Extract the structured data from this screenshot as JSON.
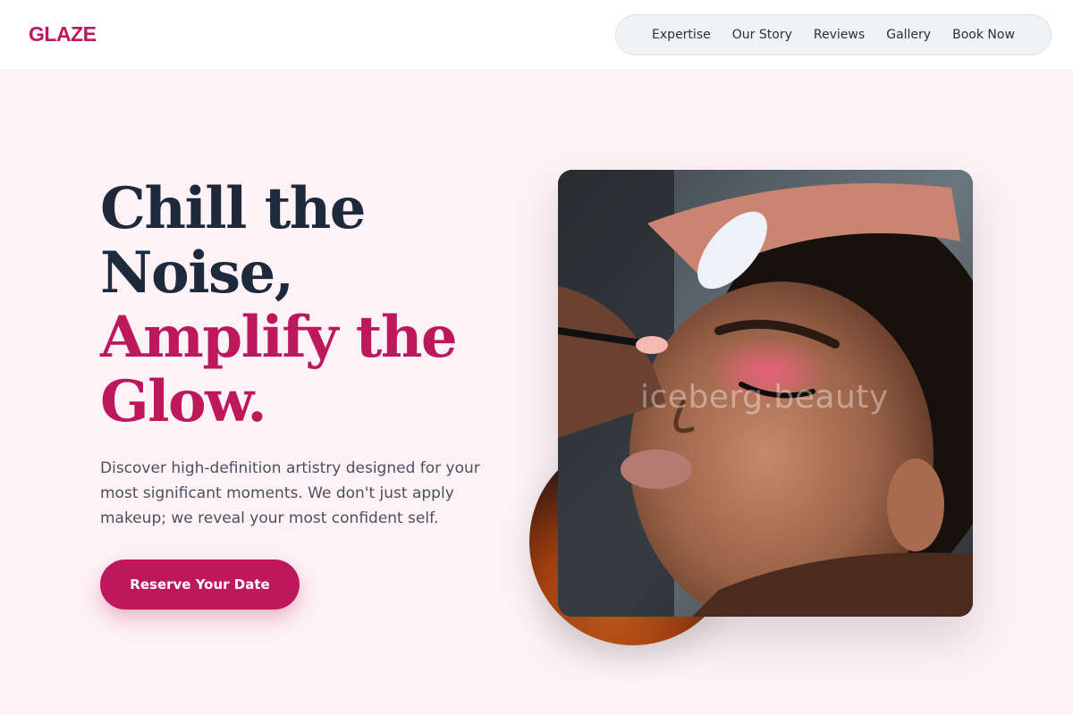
{
  "brand": {
    "logo_text": "GLAZE",
    "accent_color": "#be185d"
  },
  "nav": {
    "items": [
      {
        "label": "Expertise"
      },
      {
        "label": "Our Story"
      },
      {
        "label": "Reviews"
      },
      {
        "label": "Gallery"
      },
      {
        "label": "Book Now"
      }
    ]
  },
  "hero": {
    "title_line1": "Chill the",
    "title_line2": "Noise,",
    "title_line3": "Amplify the",
    "title_line4": "Glow.",
    "description": "Discover high-definition artistry designed for your most significant moments. We don't just apply makeup; we reveal your most confident self.",
    "cta_label": "Reserve Your Date",
    "image_watermark": "iceberg.beauty"
  }
}
